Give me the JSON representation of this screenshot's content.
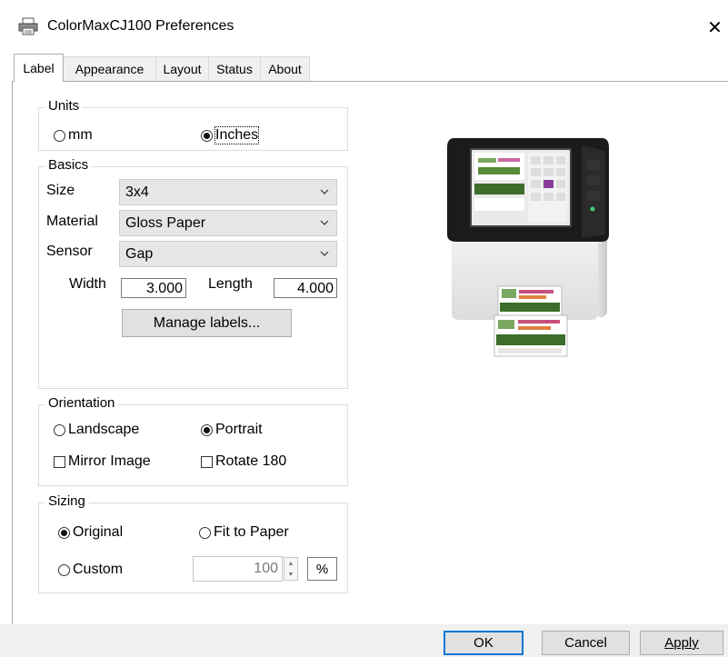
{
  "window": {
    "title": "ColorMaxCJ100 Preferences",
    "close_glyph": "✕"
  },
  "tabs": [
    {
      "label": "Label",
      "active": true
    },
    {
      "label": "Appearance",
      "active": false
    },
    {
      "label": "Layout",
      "active": false
    },
    {
      "label": "Status",
      "active": false
    },
    {
      "label": "About",
      "active": false
    }
  ],
  "units": {
    "legend": "Units",
    "options": [
      {
        "label": "mm",
        "selected": false
      },
      {
        "label": "Inches",
        "selected": true
      }
    ]
  },
  "basics": {
    "legend": "Basics",
    "size_label": "Size",
    "size_value": "3x4",
    "material_label": "Material",
    "material_value": "Gloss Paper",
    "sensor_label": "Sensor",
    "sensor_value": "Gap",
    "width_label": "Width",
    "width_value": "3.000",
    "length_label": "Length",
    "length_value": "4.000",
    "manage_button": "Manage labels..."
  },
  "orientation": {
    "legend": "Orientation",
    "landscape_label": "Landscape",
    "portrait_label": "Portrait",
    "selected": "Portrait",
    "mirror_label": "Mirror Image",
    "mirror_checked": false,
    "rotate_label": "Rotate 180",
    "rotate_checked": false
  },
  "sizing": {
    "legend": "Sizing",
    "original_label": "Original",
    "fit_label": "Fit to Paper",
    "custom_label": "Custom",
    "selected": "Original",
    "custom_value": "100",
    "custom_unit": "%"
  },
  "footer": {
    "ok": "OK",
    "cancel": "Cancel",
    "apply": "Apply"
  },
  "icons": {
    "window": "printer-icon",
    "dropdown": "chevron-down-icon",
    "spin_up": "spin-up-icon",
    "spin_down": "spin-down-icon"
  },
  "colors": {
    "focus_border": "#0078d7",
    "dropdown_bg": "#e6e6e6",
    "footer_bg": "#f0f0f0"
  }
}
